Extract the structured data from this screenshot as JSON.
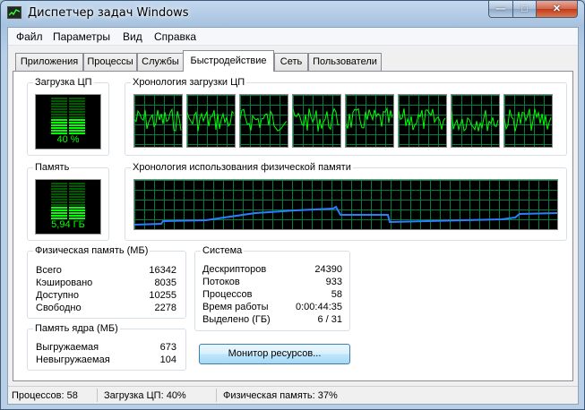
{
  "window": {
    "title": "Диспетчер задач Windows",
    "minimize_glyph": "—",
    "maximize_glyph": "□",
    "close_glyph": "✕"
  },
  "menu": [
    "Файл",
    "Параметры",
    "Вид",
    "Справка"
  ],
  "tabs": {
    "items": [
      "Приложения",
      "Процессы",
      "Службы",
      "Быстродействие",
      "Сеть",
      "Пользователи"
    ],
    "active": "Быстродействие"
  },
  "cpu": {
    "label": "Загрузка ЦП",
    "value_text": "40 %",
    "usage_fraction": 0.4
  },
  "cpu_history": {
    "label": "Хронология загрузки ЦП",
    "core_count": 8
  },
  "memory": {
    "label": "Память",
    "value_text": "5,94 ГБ",
    "usage_fraction": 0.37
  },
  "memory_history": {
    "label": "Хронология использования физической памяти"
  },
  "physical_memory": {
    "label": "Физическая память (МБ)",
    "rows": [
      {
        "label": "Всего",
        "value": "16342"
      },
      {
        "label": "Кэшировано",
        "value": "8035"
      },
      {
        "label": "Доступно",
        "value": "10255"
      },
      {
        "label": "Свободно",
        "value": "2278"
      }
    ]
  },
  "kernel_memory": {
    "label": "Память ядра (МБ)",
    "rows": [
      {
        "label": "Выгружаемая",
        "value": "673"
      },
      {
        "label": "Невыгружаемая",
        "value": "104"
      }
    ]
  },
  "system": {
    "label": "Система",
    "rows": [
      {
        "label": "Дескрипторов",
        "value": "24390"
      },
      {
        "label": "Потоков",
        "value": "933"
      },
      {
        "label": "Процессов",
        "value": "58"
      },
      {
        "label": "Время работы",
        "value": "0:00:44:35"
      },
      {
        "label": "Выделено (ГБ)",
        "value": "6 / 31"
      }
    ]
  },
  "resource_monitor_button": "Монитор ресурсов...",
  "status": {
    "processes": "Процессов: 58",
    "cpu": "Загрузка ЦП: 40%",
    "memory": "Физическая память: 37%"
  },
  "colors": {
    "graph_bg": "#000000",
    "grid": "#008040",
    "cpu_line": "#00ff00",
    "memory_line": "#2a7fff",
    "meter_on": "#00ff00",
    "meter_off": "#005a00"
  }
}
